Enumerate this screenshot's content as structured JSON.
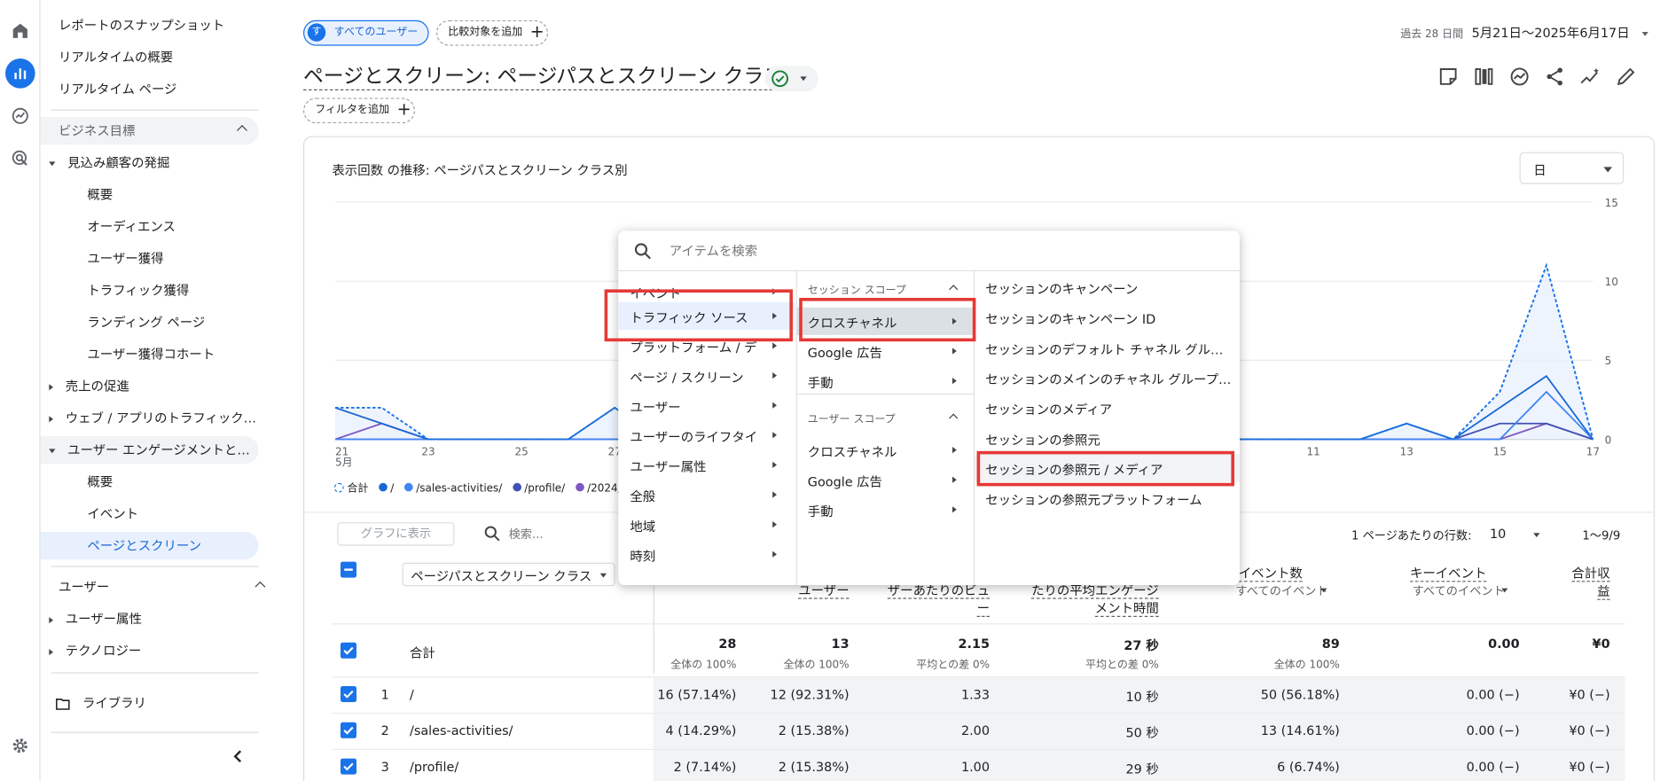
{
  "rail": {
    "icons": [
      "home-icon",
      "reports-icon",
      "explore-icon",
      "advertising-icon",
      "settings-icon"
    ]
  },
  "nav": {
    "top_items": [
      "レポートのスナップショット",
      "リアルタイムの概要",
      "リアルタイム ページ"
    ],
    "section_business": "ビジネス目標",
    "lead_group": "見込み顧客の発掘",
    "lead_items": [
      "概要",
      "オーディエンス",
      "ユーザー獲得",
      "トラフィック獲得",
      "ランディング ページ",
      "ユーザー獲得コホート"
    ],
    "sales_group": "売上の促進",
    "traffic_group": "ウェブ / アプリのトラフィック…",
    "engagement_group": "ユーザー エンゲージメントと…",
    "engagement_items": [
      "概要",
      "イベント",
      "ページとスクリーン"
    ],
    "section_user": "ユーザー",
    "user_groups": [
      "ユーザー属性",
      "テクノロジー"
    ],
    "library": "ライブラリ"
  },
  "header": {
    "segment_avatar": "す",
    "segment_label": "すべてのユーザー",
    "compare_label": "比較対象を追加",
    "date_prefix": "過去 28 日間",
    "date_range": "5月21日〜2025年6月17日",
    "title": "ページとスクリーン: ページパスとスクリーン クラス",
    "filter_label": "フィルタを追加"
  },
  "chart": {
    "title": "表示回数 の推移: ページパスとスクリーン クラス別",
    "period_select": "日",
    "legend": [
      "合計",
      "/",
      "/sales-activities/",
      "/profile/",
      "/2024/0"
    ],
    "colors": {
      "total": "#1a73e8",
      "s1": "#1967d2",
      "s2": "#4285f4",
      "s3": "#3f51b5",
      "s4": "#7e57c2"
    }
  },
  "chart_data": {
    "type": "line",
    "x": [
      "21",
      "22",
      "23",
      "24",
      "25",
      "26",
      "27",
      "28",
      "29",
      "30",
      "31",
      "1",
      "2",
      "3",
      "4",
      "5",
      "6",
      "7",
      "8",
      "9",
      "10",
      "11",
      "12",
      "13",
      "14",
      "15",
      "16",
      "17"
    ],
    "x_tick_labels": [
      "21",
      "23",
      "25",
      "27",
      "11",
      "13",
      "15",
      "17"
    ],
    "x_month_label": "5月",
    "ylim": [
      0,
      15
    ],
    "y_ticks": [
      0,
      5,
      10,
      15
    ],
    "series": [
      {
        "name": "合計",
        "values": [
          2,
          2,
          0,
          0,
          0,
          0,
          2,
          0,
          0,
          0,
          0,
          0,
          0,
          0,
          0,
          0,
          0,
          0,
          0,
          0,
          0,
          0,
          0,
          1,
          0,
          3,
          11,
          0
        ]
      },
      {
        "name": "/",
        "values": [
          2,
          1,
          0,
          0,
          0,
          0,
          2,
          0,
          0,
          0,
          0,
          0,
          0,
          0,
          0,
          0,
          0,
          0,
          0,
          0,
          0,
          0,
          0,
          1,
          0,
          2,
          4,
          0
        ]
      },
      {
        "name": "/sales-activities/",
        "values": [
          0,
          0,
          0,
          0,
          0,
          0,
          0,
          0,
          0,
          0,
          0,
          0,
          0,
          0,
          0,
          0,
          0,
          0,
          0,
          0,
          0,
          0,
          0,
          0,
          0,
          0,
          3,
          0
        ]
      },
      {
        "name": "/profile/",
        "values": [
          0,
          0,
          0,
          0,
          0,
          0,
          0,
          0,
          0,
          0,
          0,
          0,
          0,
          0,
          0,
          0,
          0,
          0,
          0,
          0,
          0,
          0,
          0,
          0,
          0,
          1,
          1,
          0
        ]
      },
      {
        "name": "/2024/0",
        "values": [
          0,
          1,
          0,
          0,
          0,
          0,
          0,
          0,
          0,
          0,
          0,
          0,
          0,
          0,
          0,
          0,
          0,
          0,
          0,
          0,
          0,
          0,
          0,
          0,
          0,
          0,
          1,
          0
        ]
      }
    ]
  },
  "toolbar": {
    "plot_button": "グラフに表示",
    "search_placeholder": "検索...",
    "rows_label": "1 ページあたりの行数:",
    "rows_value": "10",
    "pagination": "1〜9/9"
  },
  "table": {
    "dimension": "ページパスとスクリーン クラス",
    "headers": [
      {
        "l1": "",
        "l2": "ユーザー",
        "l3": ""
      },
      {
        "l1": "",
        "l2": "ザーあたりのビュ",
        "l3": "ー"
      },
      {
        "l1": "",
        "l2": "たりの平均エンゲージ",
        "l3": "メント時間"
      },
      {
        "l1": "イベント数",
        "l2": "すべてのイベント",
        "l3": ""
      },
      {
        "l1": "キーイベント",
        "l2": "すべてのイベント",
        "l3": ""
      },
      {
        "l1": "合計収",
        "l2": "益",
        "l3": ""
      }
    ],
    "totals": {
      "label": "合計",
      "cells": [
        {
          "v": "28",
          "s": "全体の 100%"
        },
        {
          "v": "13",
          "s": "全体の 100%"
        },
        {
          "v": "2.15",
          "s": "平均との差 0%"
        },
        {
          "v": "27 秒",
          "s": "平均との差 0%"
        },
        {
          "v": "89",
          "s": "全体の 100%"
        },
        {
          "v": "0.00",
          "s": ""
        },
        {
          "v": "¥0",
          "s": ""
        }
      ]
    },
    "rows": [
      {
        "n": "1",
        "path": "/",
        "cells": [
          "16 (57.14%)",
          "12 (92.31%)",
          "1.33",
          "10 秒",
          "50 (56.18%)",
          "0.00 (−)",
          "¥0 (−)"
        ]
      },
      {
        "n": "2",
        "path": "/sales-activities/",
        "cells": [
          "4 (14.29%)",
          "2 (15.38%)",
          "2.00",
          "50 秒",
          "13 (14.61%)",
          "0.00 (−)",
          "¥0 (−)"
        ]
      },
      {
        "n": "3",
        "path": "/profile/",
        "cells": [
          "2 (7.14%)",
          "2 (15.38%)",
          "1.00",
          "29 秒",
          "6 (6.74%)",
          "0.00 (−)",
          "¥0 (−)"
        ]
      }
    ]
  },
  "menu": {
    "search_placeholder": "アイテムを検索",
    "col1": [
      "イベント",
      "トラフィック ソース",
      "プラットフォーム / デ…",
      "ページ / スクリーン",
      "ユーザー",
      "ユーザーのライフタイ…",
      "ユーザー属性",
      "全般",
      "地域",
      "時刻"
    ],
    "col2_section1": "セッション スコープ",
    "col2_items1": [
      "クロスチャネル",
      "Google 広告",
      "手動"
    ],
    "col2_section2": "ユーザー スコープ",
    "col2_items2": [
      "クロスチャネル",
      "Google 広告",
      "手動"
    ],
    "col3": [
      "セッションのキャンペーン",
      "セッションのキャンペーン ID",
      "セッションのデフォルト チャネル グル…",
      "セッションのメインのチャネル グループ…",
      "セッションのメディア",
      "セッションの参照元",
      "セッションの参照元 / メディア",
      "セッションの参照元プラットフォーム"
    ]
  }
}
